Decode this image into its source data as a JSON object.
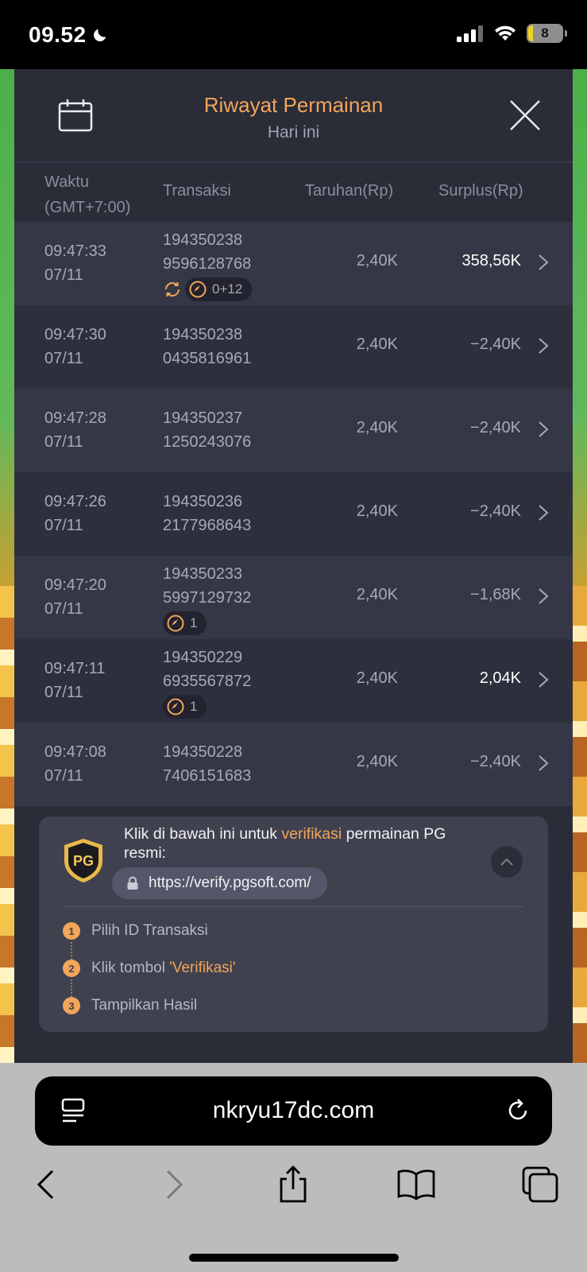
{
  "status": {
    "time": "09.52",
    "battery": "8"
  },
  "header": {
    "title": "Riwayat Permainan",
    "subtitle": "Hari ini"
  },
  "columns": {
    "time": "Waktu (GMT+7:00)",
    "transaction": "Transaksi",
    "bet": "Taruhan(Rp)",
    "surplus": "Surplus(Rp)"
  },
  "rows": [
    {
      "time": "09:47:33",
      "date": "07/11",
      "tx1": "194350238",
      "tx2": "9596128768",
      "bet": "2,40K",
      "surplus": "358,56K",
      "positive": true,
      "badges": {
        "spin": true,
        "free": "0+12"
      }
    },
    {
      "time": "09:47:30",
      "date": "07/11",
      "tx1": "194350238",
      "tx2": "0435816961",
      "bet": "2,40K",
      "surplus": "−2,40K",
      "positive": false
    },
    {
      "time": "09:47:28",
      "date": "07/11",
      "tx1": "194350237",
      "tx2": "1250243076",
      "bet": "2,40K",
      "surplus": "−2,40K",
      "positive": false
    },
    {
      "time": "09:47:26",
      "date": "07/11",
      "tx1": "194350236",
      "tx2": "2177968643",
      "bet": "2,40K",
      "surplus": "−2,40K",
      "positive": false
    },
    {
      "time": "09:47:20",
      "date": "07/11",
      "tx1": "194350233",
      "tx2": "5997129732",
      "bet": "2,40K",
      "surplus": "−1,68K",
      "positive": false,
      "badges": {
        "free": "1"
      }
    },
    {
      "time": "09:47:11",
      "date": "07/11",
      "tx1": "194350229",
      "tx2": "6935567872",
      "bet": "2,40K",
      "surplus": "2,04K",
      "positive": true,
      "badges": {
        "free": "1"
      }
    },
    {
      "time": "09:47:08",
      "date": "07/11",
      "tx1": "194350228",
      "tx2": "7406151683",
      "bet": "2,40K",
      "surplus": "−2,40K",
      "positive": false
    }
  ],
  "verify": {
    "text_before": "Klik di bawah ini untuk ",
    "text_highlight": "verifikasi",
    "text_after": " permainan PG resmi:",
    "url": "https://verify.pgsoft.com/",
    "logo_text": "PG",
    "steps": [
      {
        "num": "1",
        "before": "Pilih ID Transaksi",
        "highlight": ""
      },
      {
        "num": "2",
        "before": "Klik tombol ",
        "highlight": "'Verifikasi'"
      },
      {
        "num": "3",
        "before": "Tampilkan Hasil",
        "highlight": ""
      }
    ]
  },
  "browser": {
    "url": "nkryu17dc.com"
  },
  "colors": {
    "accent": "#f3a55a",
    "panel": "#2a2c38",
    "row_alt": "#353746",
    "card": "#3f414f"
  }
}
